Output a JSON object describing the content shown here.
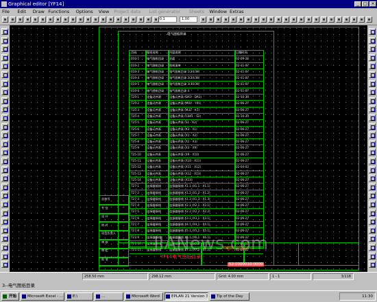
{
  "window": {
    "title": "Graphical editor [YF14]"
  },
  "menu": [
    "File",
    "Edit",
    "Draw",
    "Functions",
    "Options",
    "View",
    "Project data",
    "List generator",
    "Sheets",
    "Window",
    "Extras"
  ],
  "menu_disabled": [
    6,
    7,
    8
  ],
  "toolbar": {
    "coord": "-0.1",
    "zoom": "1.00"
  },
  "sheet": {
    "title": "电气图纸目录",
    "headers": [
      "页码",
      "图纸名称",
      "内容说明",
      "日期时间"
    ],
    "rows": [
      [
        "010-1",
        "电气图纸目录",
        "封面",
        "02-09-26"
      ],
      [
        "010-2",
        "电气图纸目录",
        "图纸清单",
        "02-11-07"
      ],
      [
        "010-3",
        "电气图纸目录",
        "电气图纸目录 1(24/30)",
        "02-11-07"
      ],
      [
        "010-4",
        "电气图纸目录",
        "电气图纸目录 2(24/30)",
        "02-11-07"
      ],
      [
        "010-5",
        "电气图纸目录",
        "电气图纸目录 3(30/30)",
        "02-11-07"
      ],
      [
        "010-6",
        "电气图纸目录",
        "电气图纸目录 4",
        "02-11-07"
      ],
      [
        "T25-1",
        "设备元件表",
        "设备元件表 (DA1 - DA1)",
        "02-10-30"
      ],
      [
        "T25-2",
        "设备元件表",
        "设备元件表 (M01 - Y01)",
        "02-06-27"
      ],
      [
        "T25-3",
        "设备元件表",
        "设备元件表 (M32 - K1)",
        "02-06-27"
      ],
      [
        "T25-4",
        "设备元件表",
        "设备元件表 (CB01 - S2)",
        "02-10-30"
      ],
      [
        "T25-5",
        "设备元件表",
        "设备元件表 (S1 - K2)",
        "02-06-27"
      ],
      [
        "T25-6",
        "设备元件表",
        "设备元件表 (K3 - X1)",
        "02-06-27"
      ],
      [
        "T25-7",
        "设备元件表",
        "设备元件表 (X1 - X2)",
        "02-06-27"
      ],
      [
        "T25-8",
        "设备元件表",
        "设备元件表 (X2 - X3)",
        "02-06-27"
      ],
      [
        "T25-9",
        "设备元件表",
        "设备元件表 (X3 - X9)",
        "02-06-27"
      ],
      [
        "T25-10",
        "设备元件表",
        "设备元件表 (X9 - X10)",
        "02-06-27"
      ],
      [
        "T25-11",
        "设备元件表",
        "设备元件表 (X10 - X11)",
        "02-06-27"
      ],
      [
        "T25-12",
        "设备元件表",
        "设备元件表 (X11 - X12)",
        "02-04-02"
      ],
      [
        "T25-13",
        "设备元件表",
        "设备元件表 (X12 - X13)",
        "02-06-27"
      ],
      [
        "T25-14",
        "设备元件表",
        "设备元件表 (X13)",
        "02-06-27"
      ],
      [
        "T27-1",
        "连接器接线",
        "连接器接线 X1.1 (X1.1 - X1.1)",
        "02-06-27"
      ],
      [
        "T27-2",
        "连接器接线",
        "连接器接线 X1.2 (X1.2 - X1.2)",
        "02-06-27"
      ],
      [
        "T27-3",
        "连接器接线",
        "连接器接线 X1.3 (X1.3 - X1.3)",
        "02-06-27"
      ],
      [
        "T27-4",
        "连接器接线",
        "连接器接线 X2.1 (X2.1 - X2.1)",
        "02-06-27"
      ],
      [
        "T27-5",
        "连接器接线",
        "连接器接线 X2.2 (X2.2 - X2.2)",
        "02-06-27"
      ],
      [
        "T27-6",
        "连接器接线",
        "连接器接线 X3.1 (X3.1 - X3.1)",
        "02-06-27"
      ],
      [
        "T27-7",
        "连接器接线",
        "连接器接线 X4.1 (X4.1 - X4.1)",
        "02-06-27"
      ],
      [
        "T27-8",
        "连接器接线",
        "连接器接线 X5.1 (X5.1 - X5.1)",
        "02-06-27"
      ],
      [
        "T27-9",
        "连接器接线",
        "连接器接线 X6.1 (X6.1 - X6.1)",
        "02-06-27"
      ],
      [
        "T27-10",
        "连接器接线",
        "连接器接线 X7.1 (X7.1 - X7.1)",
        "02-06-27"
      ],
      [
        "T27-11",
        "连接器接线",
        "连接器接线 X7.2 (X7.2 - X7.2)",
        "02-06-27"
      ]
    ],
    "left_labels": [
      "总装号",
      "专  业",
      "设  计",
      "校  对",
      "项目负责人",
      "审  核",
      "审  定",
      "批  准"
    ],
    "titleblock": {
      "project": "YF14电气图纸目录",
      "org": "中国科学院某中心",
      "code": "52-0000010-0000"
    },
    "watermark": "IIANews.com"
  },
  "status": {
    "x": "258.50 mm",
    "y": "298.12 mm",
    "grid": "Grid: 4.00 mm",
    "page": "1 - 1",
    "total": "3/118"
  },
  "docbar": {
    "label": "3--电气图纸目录"
  },
  "taskbar": {
    "start": "开始",
    "tasks": [
      "Microsoft Excel - ...",
      "E:\\",
      "...",
      "Microsoft Word",
      "EPLAN 21 Version 3.2",
      "Tip of the Day"
    ],
    "active": 4,
    "clock": "11:30"
  }
}
